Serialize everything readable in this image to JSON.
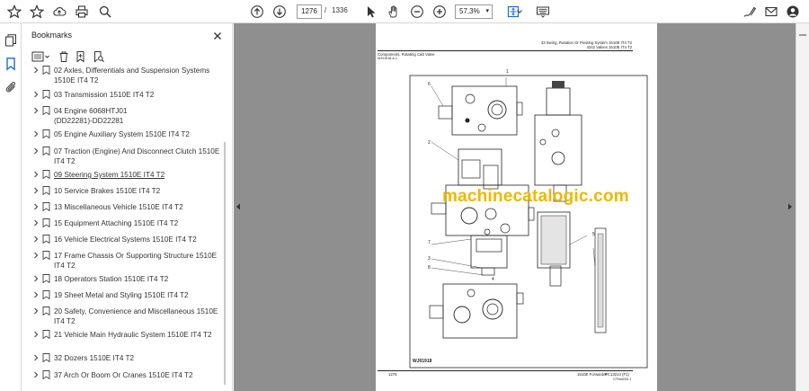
{
  "toolbar": {
    "current_page": "1276",
    "page_separator": "/",
    "total_pages": "1336",
    "zoom": "57,3%"
  },
  "panel": {
    "title": "Bookmarks"
  },
  "bookmarks": [
    {
      "label": "02 Axles, Differentials and Suspension Systems 1510E IT4 T2",
      "active": false
    },
    {
      "label": "03 Transmission 1510E IT4 T2",
      "active": false
    },
    {
      "label": "04 Engine 6068HTJ01 (DD22281)-DD22281",
      "active": false
    },
    {
      "label": "05 Engine Auxiliary System 1510E IT4 T2",
      "active": false
    },
    {
      "label": "07 Traction (Engine) And Disconnect Clutch 1510E IT4 T2",
      "active": false
    },
    {
      "label": "09 Steering System 1510E IT4 T2",
      "active": true
    },
    {
      "label": "10 Service Brakes 1510E IT4 T2",
      "active": false
    },
    {
      "label": "13 Miscellaneous Vehicle 1510E IT4 T2",
      "active": false
    },
    {
      "label": "15 Equipment Attaching 1510E IT4 T2",
      "active": false
    },
    {
      "label": "16 Vehicle Electrical Systems 1510E IT4 T2",
      "active": false
    },
    {
      "label": "17 Frame Chassis Or Supporting Structure 1510E IT4 T2",
      "active": false
    },
    {
      "label": "18 Operators Station 1510E IT4 T2",
      "active": false
    },
    {
      "label": "19 Sheet Metal and Styling 1510E IT4 T2",
      "active": false
    },
    {
      "label": "20 Safety, Convenience and Miscellaneous 1510E IT4 T2",
      "active": false
    },
    {
      "label": "21 Vehicle Main Hydraulic System 1510E IT4 T2",
      "active": false
    },
    {
      "label": "32 Dozers 1510E IT4 T2",
      "active": false
    },
    {
      "label": "37 Arch Or Boom Or Cranes 1510E IT4 T2",
      "active": false
    }
  ],
  "document": {
    "header_right_1": "43 Swing, Rotation Or Pivoting System 1510E IT4 T2",
    "header_right_2": "4242 Valves 1510E IT4 T2",
    "header_left_1": "Components, Rotating Cab Valve",
    "header_left_2": "WJ01918-A-1",
    "watermark": "machinecatalogic.com",
    "figure_id": "WJ01918",
    "callouts": [
      "1",
      "2",
      "3",
      "4",
      "5",
      "6",
      "7",
      "8"
    ],
    "footer_page": "1276",
    "footer_model": "1510E Forwarder",
    "footer_doc": "PC13214 (F1)",
    "footer_date": "17Feb2020-1"
  }
}
